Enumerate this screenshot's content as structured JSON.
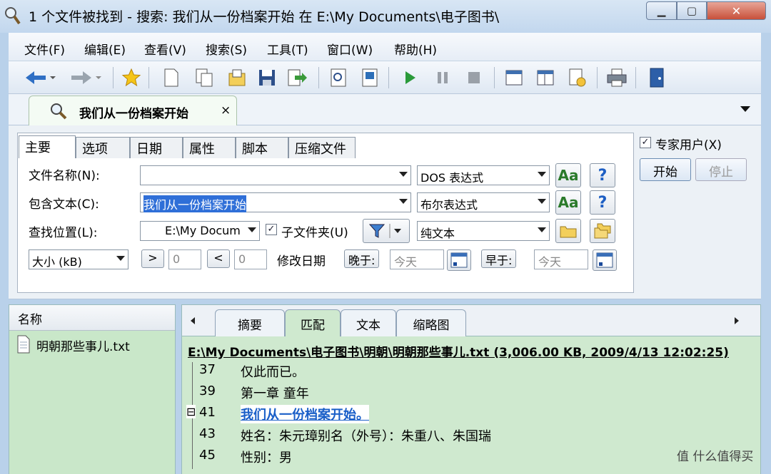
{
  "window": {
    "title": "1 个文件被找到 - 搜索: 我们从一份档案开始 在 E:\\My Documents\\电子图书\\"
  },
  "menu": [
    "文件(F)",
    "编辑(E)",
    "查看(V)",
    "搜索(S)",
    "工具(T)",
    "窗口(W)",
    "帮助(H)"
  ],
  "search_tab": {
    "label": "我们从一份档案开始",
    "close": "×"
  },
  "form": {
    "tabs": [
      "主要",
      "选项",
      "日期",
      "属性",
      "脚本",
      "压缩文件"
    ],
    "filename_label": "文件名称(N):",
    "filename_value": "",
    "filename_mode": "DOS 表达式",
    "text_label": "包含文本(C):",
    "text_value": "我们从一份档案开始",
    "text_mode": "布尔表达式",
    "location_label": "查找位置(L):",
    "location_value": "E:\\My Docum",
    "subfolder_label": "子文件夹(U)",
    "location_mode": "纯文本",
    "size_mode": "大小 (kB)",
    "size_gt": ">",
    "size_gt_value": "0",
    "size_lt": "<",
    "size_lt_value": "0",
    "modified_label": "修改日期",
    "after_label": "晚于:",
    "after_value": "今天",
    "before_label": "早于:",
    "before_value": "今天",
    "aa": "Aa",
    "help": "?"
  },
  "side": {
    "expert_label": "专家用户(X)",
    "start": "开始",
    "stop": "停止"
  },
  "results": {
    "header": "名称",
    "files": [
      "明朝那些事儿.txt"
    ]
  },
  "preview": {
    "tabs": [
      "摘要",
      "匹配",
      "文本",
      "缩略图"
    ],
    "path": "E:\\My Documents\\电子图书\\明朝\\明朝那些事儿.txt (3,006.00 KB, 2009/4/13 12:02:25)",
    "lines": [
      {
        "n": "37",
        "text": "仅此而已。"
      },
      {
        "n": "39",
        "text": "第一章 童年"
      },
      {
        "n": "41",
        "text": "我们从一份档案开始。",
        "highlight": true
      },
      {
        "n": "43",
        "text": "姓名：朱元璋别名（外号）：朱重八、朱国瑞"
      },
      {
        "n": "45",
        "text": "性别：男"
      }
    ],
    "collapse": "⊟"
  },
  "watermark": "值 什么值得买"
}
